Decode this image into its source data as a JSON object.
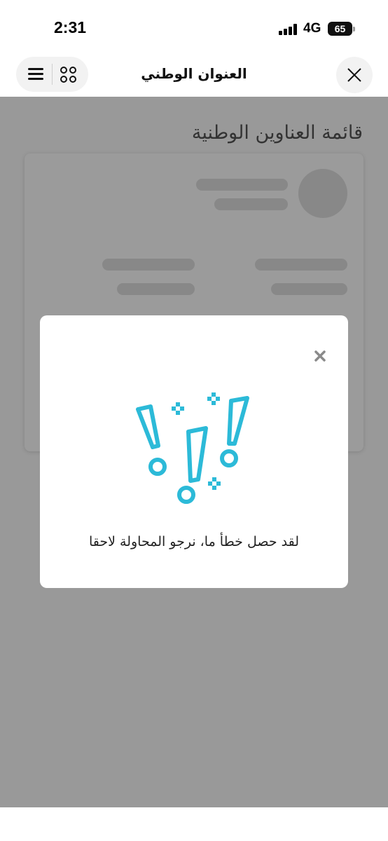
{
  "status_bar": {
    "time": "2:31",
    "network": "4G",
    "battery": "65"
  },
  "header": {
    "title": "العنوان الوطني"
  },
  "page": {
    "title": "قائمة العناوين الوطنية"
  },
  "modal": {
    "message": "لقد حصل خطأ ما، نرجو المحاولة لاحقا"
  },
  "colors": {
    "accent": "#2cbad8",
    "overlay": "#999999"
  },
  "icons": {
    "menu": "hamburger-icon",
    "apps": "apps-grid-icon",
    "close": "close-icon",
    "error": "exclamation-marks-illustration"
  }
}
